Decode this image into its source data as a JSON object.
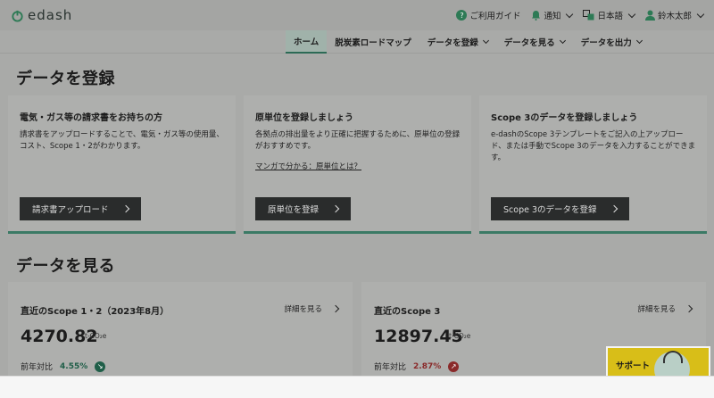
{
  "brand": {
    "name": "edash"
  },
  "top": {
    "guide": "ご利用ガイド",
    "notify": "通知",
    "lang": "日本語",
    "user": "鈴木太郎"
  },
  "nav": [
    {
      "label": "ホーム",
      "active": true
    },
    {
      "label": "脱炭素ロードマップ"
    },
    {
      "label": "データを登録"
    },
    {
      "label": "データを見る"
    },
    {
      "label": "データを出力"
    }
  ],
  "register": {
    "title": "データを登録",
    "cards": [
      {
        "title": "電気・ガス等の請求書をお持ちの方",
        "desc": "請求書をアップロードすることで、電気・ガス等の使用量、コスト、Scope 1・2がわかります。",
        "button": "請求書アップロード"
      },
      {
        "title": "原単位を登録しましょう",
        "desc": "各拠点の排出量をより正確に把握するために、原単位の登録がおすすめです。",
        "link": "マンガで分かる：原単位とは？",
        "button": "原単位を登録"
      },
      {
        "title": "Scope 3のデータを登録しましょう",
        "desc": "e-dashのScope 3テンプレートをご記入の上アップロード、または手動でScope 3のデータを入力することができます。",
        "button": "Scope 3のデータを登録"
      }
    ]
  },
  "view": {
    "title": "データを見る",
    "cards": [
      {
        "title": "直近のScope 1・2（2023年8月）",
        "more": "詳細を見る",
        "value": "4270.82",
        "unit": "t-CO₂e",
        "compare_label": "前年対比",
        "compare_value": "4.55%"
      },
      {
        "title": "直近のScope 3",
        "more": "詳細を見る",
        "value": "12897.45",
        "unit": "t-CO₂e",
        "compare_label": "前年対比",
        "compare_value": "2.87%"
      }
    ]
  },
  "support": {
    "label": "サポート"
  },
  "colors": {
    "accent": "#2c6a55",
    "good": "#1f5e48",
    "bad": "#8a2a2a",
    "support": "#d8be18"
  }
}
